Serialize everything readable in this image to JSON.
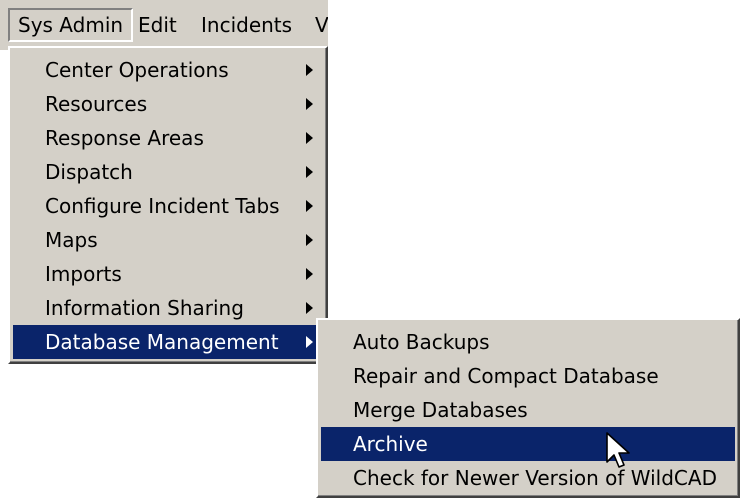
{
  "menubar": {
    "items": [
      {
        "label": "Sys Admin"
      },
      {
        "label": "Edit"
      },
      {
        "label": "Incidents"
      },
      {
        "label": "V"
      }
    ]
  },
  "sysadmin_menu": {
    "items": [
      {
        "label": "Center Operations",
        "has_submenu": true
      },
      {
        "label": "Resources",
        "has_submenu": true
      },
      {
        "label": "Response Areas",
        "has_submenu": true
      },
      {
        "label": "Dispatch",
        "has_submenu": true
      },
      {
        "label": "Configure Incident Tabs",
        "has_submenu": true
      },
      {
        "label": "Maps",
        "has_submenu": true
      },
      {
        "label": "Imports",
        "has_submenu": true
      },
      {
        "label": "Information Sharing",
        "has_submenu": true
      },
      {
        "label": "Database Management",
        "has_submenu": true,
        "selected": true
      }
    ]
  },
  "database_management_submenu": {
    "items": [
      {
        "label": "Auto Backups"
      },
      {
        "label": "Repair and Compact Database"
      },
      {
        "label": "Merge Databases"
      },
      {
        "label": "Archive",
        "selected": true
      },
      {
        "label": "Check for Newer Version of WildCAD"
      }
    ]
  },
  "colors": {
    "menu_background": "#d4d0c8",
    "selection_background": "#0a246a",
    "selection_text": "#ffffff"
  },
  "cursor": {
    "icon": "arrow-pointer-icon"
  }
}
